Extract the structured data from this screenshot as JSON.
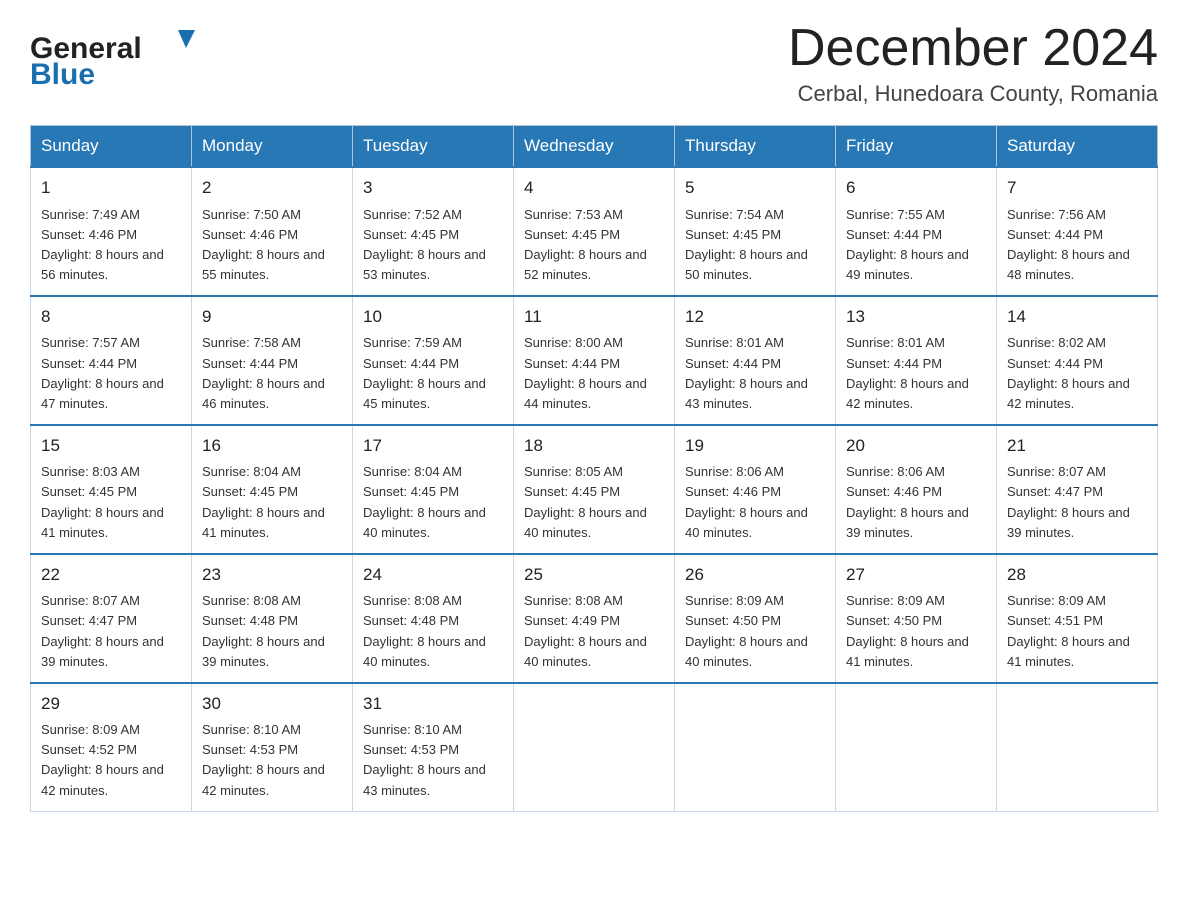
{
  "header": {
    "logo_general": "General",
    "logo_blue": "Blue",
    "month_title": "December 2024",
    "location": "Cerbal, Hunedoara County, Romania"
  },
  "weekdays": [
    "Sunday",
    "Monday",
    "Tuesday",
    "Wednesday",
    "Thursday",
    "Friday",
    "Saturday"
  ],
  "weeks": [
    [
      {
        "day": "1",
        "sunrise": "7:49 AM",
        "sunset": "4:46 PM",
        "daylight": "8 hours and 56 minutes."
      },
      {
        "day": "2",
        "sunrise": "7:50 AM",
        "sunset": "4:46 PM",
        "daylight": "8 hours and 55 minutes."
      },
      {
        "day": "3",
        "sunrise": "7:52 AM",
        "sunset": "4:45 PM",
        "daylight": "8 hours and 53 minutes."
      },
      {
        "day": "4",
        "sunrise": "7:53 AM",
        "sunset": "4:45 PM",
        "daylight": "8 hours and 52 minutes."
      },
      {
        "day": "5",
        "sunrise": "7:54 AM",
        "sunset": "4:45 PM",
        "daylight": "8 hours and 50 minutes."
      },
      {
        "day": "6",
        "sunrise": "7:55 AM",
        "sunset": "4:44 PM",
        "daylight": "8 hours and 49 minutes."
      },
      {
        "day": "7",
        "sunrise": "7:56 AM",
        "sunset": "4:44 PM",
        "daylight": "8 hours and 48 minutes."
      }
    ],
    [
      {
        "day": "8",
        "sunrise": "7:57 AM",
        "sunset": "4:44 PM",
        "daylight": "8 hours and 47 minutes."
      },
      {
        "day": "9",
        "sunrise": "7:58 AM",
        "sunset": "4:44 PM",
        "daylight": "8 hours and 46 minutes."
      },
      {
        "day": "10",
        "sunrise": "7:59 AM",
        "sunset": "4:44 PM",
        "daylight": "8 hours and 45 minutes."
      },
      {
        "day": "11",
        "sunrise": "8:00 AM",
        "sunset": "4:44 PM",
        "daylight": "8 hours and 44 minutes."
      },
      {
        "day": "12",
        "sunrise": "8:01 AM",
        "sunset": "4:44 PM",
        "daylight": "8 hours and 43 minutes."
      },
      {
        "day": "13",
        "sunrise": "8:01 AM",
        "sunset": "4:44 PM",
        "daylight": "8 hours and 42 minutes."
      },
      {
        "day": "14",
        "sunrise": "8:02 AM",
        "sunset": "4:44 PM",
        "daylight": "8 hours and 42 minutes."
      }
    ],
    [
      {
        "day": "15",
        "sunrise": "8:03 AM",
        "sunset": "4:45 PM",
        "daylight": "8 hours and 41 minutes."
      },
      {
        "day": "16",
        "sunrise": "8:04 AM",
        "sunset": "4:45 PM",
        "daylight": "8 hours and 41 minutes."
      },
      {
        "day": "17",
        "sunrise": "8:04 AM",
        "sunset": "4:45 PM",
        "daylight": "8 hours and 40 minutes."
      },
      {
        "day": "18",
        "sunrise": "8:05 AM",
        "sunset": "4:45 PM",
        "daylight": "8 hours and 40 minutes."
      },
      {
        "day": "19",
        "sunrise": "8:06 AM",
        "sunset": "4:46 PM",
        "daylight": "8 hours and 40 minutes."
      },
      {
        "day": "20",
        "sunrise": "8:06 AM",
        "sunset": "4:46 PM",
        "daylight": "8 hours and 39 minutes."
      },
      {
        "day": "21",
        "sunrise": "8:07 AM",
        "sunset": "4:47 PM",
        "daylight": "8 hours and 39 minutes."
      }
    ],
    [
      {
        "day": "22",
        "sunrise": "8:07 AM",
        "sunset": "4:47 PM",
        "daylight": "8 hours and 39 minutes."
      },
      {
        "day": "23",
        "sunrise": "8:08 AM",
        "sunset": "4:48 PM",
        "daylight": "8 hours and 39 minutes."
      },
      {
        "day": "24",
        "sunrise": "8:08 AM",
        "sunset": "4:48 PM",
        "daylight": "8 hours and 40 minutes."
      },
      {
        "day": "25",
        "sunrise": "8:08 AM",
        "sunset": "4:49 PM",
        "daylight": "8 hours and 40 minutes."
      },
      {
        "day": "26",
        "sunrise": "8:09 AM",
        "sunset": "4:50 PM",
        "daylight": "8 hours and 40 minutes."
      },
      {
        "day": "27",
        "sunrise": "8:09 AM",
        "sunset": "4:50 PM",
        "daylight": "8 hours and 41 minutes."
      },
      {
        "day": "28",
        "sunrise": "8:09 AM",
        "sunset": "4:51 PM",
        "daylight": "8 hours and 41 minutes."
      }
    ],
    [
      {
        "day": "29",
        "sunrise": "8:09 AM",
        "sunset": "4:52 PM",
        "daylight": "8 hours and 42 minutes."
      },
      {
        "day": "30",
        "sunrise": "8:10 AM",
        "sunset": "4:53 PM",
        "daylight": "8 hours and 42 minutes."
      },
      {
        "day": "31",
        "sunrise": "8:10 AM",
        "sunset": "4:53 PM",
        "daylight": "8 hours and 43 minutes."
      },
      null,
      null,
      null,
      null
    ]
  ]
}
